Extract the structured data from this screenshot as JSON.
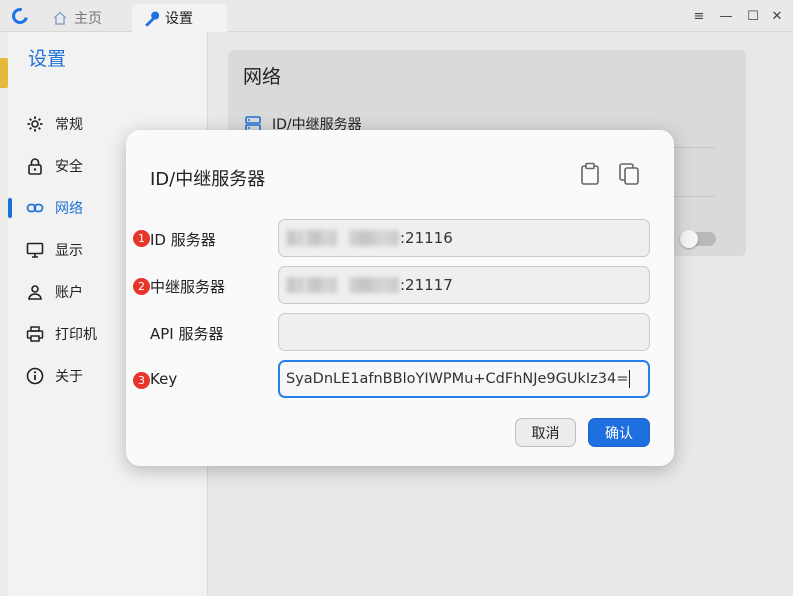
{
  "titlebar": {
    "tabs": [
      {
        "label": "主页",
        "icon": "home-icon"
      },
      {
        "label": "设置",
        "icon": "wrench-icon"
      }
    ],
    "controls": {
      "menu": "≡",
      "minimize": "—",
      "maximize": "☐",
      "close": "✕"
    }
  },
  "sidebar": {
    "title": "设置",
    "items": [
      {
        "label": "常规",
        "icon": "gear-icon"
      },
      {
        "label": "安全",
        "icon": "lock-icon"
      },
      {
        "label": "网络",
        "icon": "link-icon",
        "active": true
      },
      {
        "label": "显示",
        "icon": "monitor-icon"
      },
      {
        "label": "账户",
        "icon": "person-icon"
      },
      {
        "label": "打印机",
        "icon": "printer-icon"
      },
      {
        "label": "关于",
        "icon": "info-icon"
      }
    ]
  },
  "main": {
    "card_title": "网络",
    "server_row_label": "ID/中继服务器"
  },
  "dialog": {
    "title": "ID/中继服务器",
    "fields": [
      {
        "badge": "1",
        "label": "ID 服务器",
        "value": ":21116"
      },
      {
        "badge": "2",
        "label": "中继服务器",
        "value": ":21117"
      },
      {
        "badge": "",
        "label": "API 服务器",
        "value": ""
      },
      {
        "badge": "3",
        "label": "Key",
        "value": "SyaDnLE1afnBBloYIWPMu+CdFhNJe9GUkIz34="
      }
    ],
    "cancel_label": "取消",
    "ok_label": "确认"
  },
  "colors": {
    "accent": "#1e73d6",
    "badge": "#e8352c",
    "primary_button": "#1e6fe0"
  }
}
